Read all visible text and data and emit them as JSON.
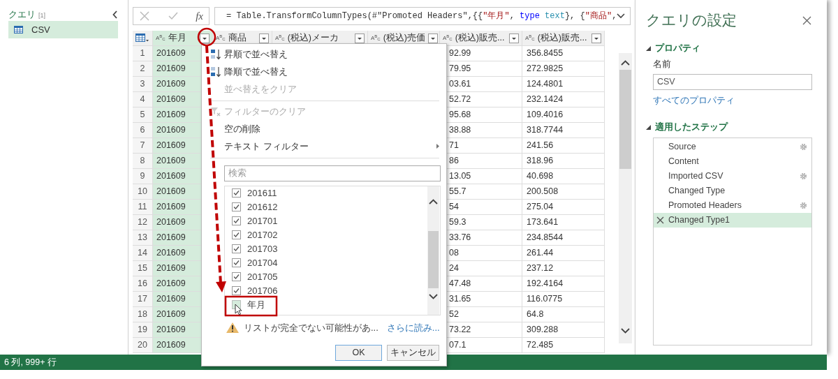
{
  "queries_pane": {
    "title": "クエリ",
    "count": "[1]",
    "items": [
      {
        "label": "CSV",
        "selected": true
      }
    ]
  },
  "formula_bar": {
    "fx_label": "fx",
    "tokens": [
      {
        "kind": "plain",
        "text": "= Table.TransformColumnTypes(#\"Promoted Headers\",{{"
      },
      {
        "kind": "string",
        "text": "\"年月\""
      },
      {
        "kind": "plain",
        "text": ", "
      },
      {
        "kind": "keyword",
        "text": "type"
      },
      {
        "kind": "type",
        "text": " text"
      },
      {
        "kind": "plain",
        "text": "}, {"
      },
      {
        "kind": "string",
        "text": "\"商品\""
      },
      {
        "kind": "plain",
        "text": ","
      }
    ]
  },
  "table": {
    "columns": [
      {
        "type_label": "A$^{B}$$_{C}$",
        "label": "年月",
        "selected": true
      },
      {
        "type_label": "A$^{B}$$_{C}$",
        "label": "商品",
        "selected": false
      },
      {
        "type_label": "A$^{B}$$_{C}$",
        "label": "(税込)メーカ",
        "selected": false
      },
      {
        "type_label": "A$^{B}$$_{C}$",
        "label": "(税込)売価",
        "selected": false
      },
      {
        "type_label": "A$^{B}$$_{C}$",
        "label": "(税込)販売...",
        "selected": false
      },
      {
        "type_label": "A$^{B}$$_{C}$",
        "label": "(税込)販売...",
        "selected": false
      }
    ],
    "rows": [
      {
        "number": "1",
        "cells": [
          "201609",
          "92.99",
          "356.8455"
        ]
      },
      {
        "number": "2",
        "cells": [
          "201609",
          "79.95",
          "272.9825"
        ]
      },
      {
        "number": "3",
        "cells": [
          "201609",
          "03.61",
          "124.4801"
        ]
      },
      {
        "number": "4",
        "cells": [
          "201609",
          "52.72",
          "232.1424"
        ]
      },
      {
        "number": "5",
        "cells": [
          "201609",
          "95.68",
          "109.4016"
        ]
      },
      {
        "number": "6",
        "cells": [
          "201609",
          "38.88",
          "318.7744"
        ]
      },
      {
        "number": "7",
        "cells": [
          "201609",
          "71",
          "241.56"
        ]
      },
      {
        "number": "8",
        "cells": [
          "201609",
          "86",
          "318.96"
        ]
      },
      {
        "number": "9",
        "cells": [
          "201609",
          "13.05",
          "40.698"
        ]
      },
      {
        "number": "10",
        "cells": [
          "201609",
          "55.7",
          "200.508"
        ]
      },
      {
        "number": "11",
        "cells": [
          "201609",
          "54",
          "275.04"
        ]
      },
      {
        "number": "12",
        "cells": [
          "201609",
          "59.3",
          "173.641"
        ]
      },
      {
        "number": "13",
        "cells": [
          "201609",
          "33.76",
          "234.8544"
        ]
      },
      {
        "number": "14",
        "cells": [
          "201609",
          "08",
          "261.44"
        ]
      },
      {
        "number": "15",
        "cells": [
          "201609",
          "24",
          "237.12"
        ]
      },
      {
        "number": "16",
        "cells": [
          "201609",
          "47.48",
          "192.4164"
        ]
      },
      {
        "number": "17",
        "cells": [
          "201609",
          "31.65",
          "116.0775"
        ]
      },
      {
        "number": "18",
        "cells": [
          "201609",
          "52",
          "64.8"
        ]
      },
      {
        "number": "19",
        "cells": [
          "201609",
          "73.22",
          "309.288"
        ]
      },
      {
        "number": "20",
        "cells": [
          "201609",
          "07.1",
          "72.485"
        ]
      }
    ]
  },
  "filter_menu": {
    "groups": [
      [
        {
          "kind": "sort_ascending",
          "label": "昇順で並べ替え",
          "disabled": false
        },
        {
          "kind": "sort_descending",
          "label": "降順で並べ替え",
          "disabled": false
        },
        {
          "kind": "command",
          "label": "並べ替えをクリア",
          "disabled": true
        }
      ],
      [
        {
          "kind": "clear_filter",
          "label": "フィルターのクリア",
          "disabled": true
        },
        {
          "kind": "command",
          "label": "空の削除",
          "disabled": false
        },
        {
          "kind": "submenu",
          "label": "テキスト フィルター",
          "disabled": false
        }
      ]
    ],
    "search": {
      "placeholder": "検索"
    },
    "values": [
      {
        "label": "201611",
        "checked": true
      },
      {
        "label": "201612",
        "checked": true
      },
      {
        "label": "201701",
        "checked": true
      },
      {
        "label": "201702",
        "checked": true
      },
      {
        "label": "201703",
        "checked": true
      },
      {
        "label": "201704",
        "checked": true
      },
      {
        "label": "201705",
        "checked": true
      },
      {
        "label": "201706",
        "checked": true
      },
      {
        "label": "年月",
        "checked": false
      }
    ],
    "warning": "リストが完全でない可能性があ...",
    "load_more": "さらに読み...",
    "buttons": [
      "OK",
      "キャンセル"
    ]
  },
  "settings_pane": {
    "title": "クエリの設定",
    "properties": {
      "heading": "プロパティ",
      "name_label": "名前",
      "name_value": "CSV",
      "all_properties": "すべてのプロパティ"
    },
    "steps_heading": "適用したステップ",
    "steps": [
      {
        "label": "Source",
        "has_settings": true,
        "selected": false
      },
      {
        "label": "Content",
        "has_settings": false,
        "selected": false
      },
      {
        "label": "Imported CSV",
        "has_settings": true,
        "selected": false
      },
      {
        "label": "Changed Type",
        "has_settings": false,
        "selected": false
      },
      {
        "label": "Promoted Headers",
        "has_settings": true,
        "selected": false
      },
      {
        "label": "Changed Type1",
        "has_settings": false,
        "selected": true
      }
    ]
  },
  "status_bar": "6 列, 999+ 行"
}
